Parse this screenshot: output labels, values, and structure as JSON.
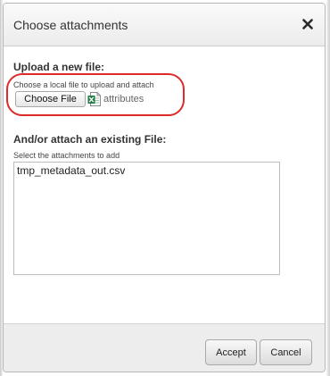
{
  "dialog": {
    "title": "Choose attachments",
    "close_icon": "close-icon"
  },
  "upload": {
    "heading": "Upload a new file:",
    "hint": "Choose a local file to upload and attach",
    "choose_button_label": "Choose File",
    "file_icon": "excel-file-icon",
    "file_name": "attributes"
  },
  "existing": {
    "heading": "And/or attach an existing File:",
    "hint": "Select the attachments to add",
    "items": [
      "tmp_metadata_out.csv"
    ]
  },
  "footer": {
    "accept_label": "Accept",
    "cancel_label": "Cancel"
  },
  "colors": {
    "highlight": "#dd2a2a",
    "excel_green": "#1f7a45"
  }
}
